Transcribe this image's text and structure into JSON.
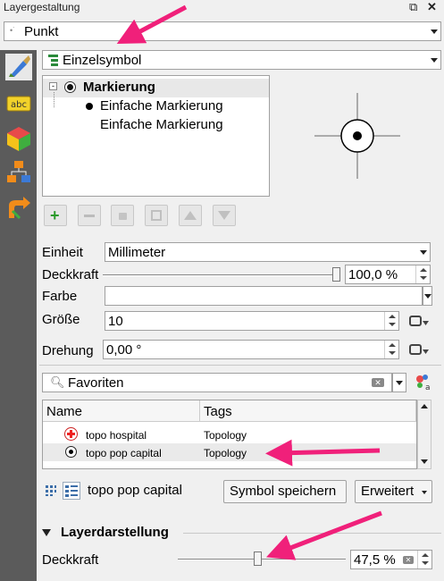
{
  "window": {
    "title": "Layergestaltung",
    "float_icon": "restore-icon",
    "close_icon": "close-icon"
  },
  "renderer": {
    "value": "Punkt"
  },
  "symbol_type": {
    "value": "Einzelsymbol"
  },
  "symbol_tree": {
    "root": "Markierung",
    "children": [
      "Einfache Markierung",
      "Einfache Markierung"
    ]
  },
  "properties": {
    "unit_label": "Einheit",
    "unit_value": "Millimeter",
    "opacity_label": "Deckkraft",
    "opacity_value": "100,0 %",
    "color_label": "Farbe",
    "size_label": "Größe",
    "size_value": "10",
    "rotation_label": "Drehung",
    "rotation_value": "0,00 °"
  },
  "search": {
    "value": "Favoriten"
  },
  "symbol_list": {
    "columns": [
      "Name",
      "Tags"
    ],
    "rows": [
      {
        "name": "topo hospital",
        "tags": "Topology"
      },
      {
        "name": "topo pop capital",
        "tags": "Topology"
      }
    ]
  },
  "footer": {
    "symbol_name": "topo pop capital",
    "save_label": "Symbol speichern",
    "advanced_label": "Erweitert"
  },
  "layer_rendering": {
    "section_title": "Layerdarstellung",
    "opacity_label": "Deckkraft",
    "opacity_value": "47,5 %",
    "opacity_fraction": 0.475
  },
  "colors": {
    "annotation_arrow": "#f0207a",
    "sidebar": "#5b5b5b"
  }
}
